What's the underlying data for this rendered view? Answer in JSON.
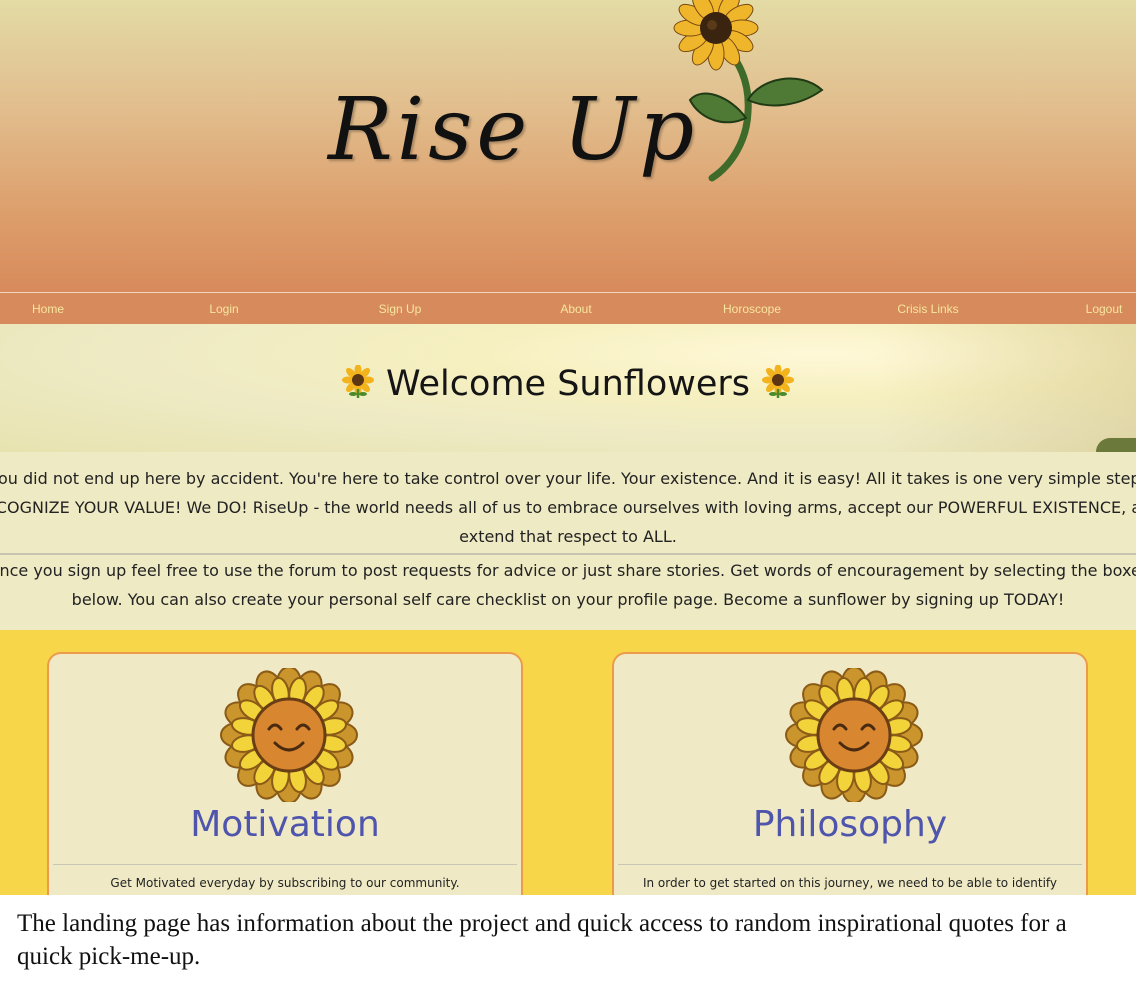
{
  "brand": {
    "title": "Rise Up"
  },
  "nav": {
    "items": [
      "Home",
      "Login",
      "Sign Up",
      "About",
      "Horoscope",
      "Crisis Links",
      "Logout"
    ]
  },
  "banner": {
    "heading": "Welcome Sunflowers"
  },
  "intro": {
    "paragraph1": "You did not end up here by accident. You're here to take control over your life. Your existence. And it is easy! All it takes is one very simple step. RECOGNIZE YOUR VALUE! We DO! RiseUp - the world needs all of us to embrace ourselves with loving arms, accept our POWERFUL EXISTENCE, and extend that respect to ALL.",
    "paragraph2": "Once you sign up feel free to use the forum to post requests for advice or just share stories. Get words of encouragement by selecting the boxes below. You can also create your personal self care checklist on your profile page. Become a sunflower by signing up TODAY!"
  },
  "cards": [
    {
      "title": "Motivation",
      "text": "Get Motivated everyday by subscribing to our community."
    },
    {
      "title": "Philosophy",
      "text": "In order to get started on this journey, we need to be able to identify"
    }
  ],
  "caption": "The landing page has information about the project and quick access to random inspirational quotes for a quick pick-me-up.",
  "colors": {
    "nav_bg": "#d78a5b",
    "nav_text": "#f7e7a0",
    "card_title": "#4f55ad",
    "cards_bg": "#f7d649",
    "card_border": "#ec9b4a"
  }
}
